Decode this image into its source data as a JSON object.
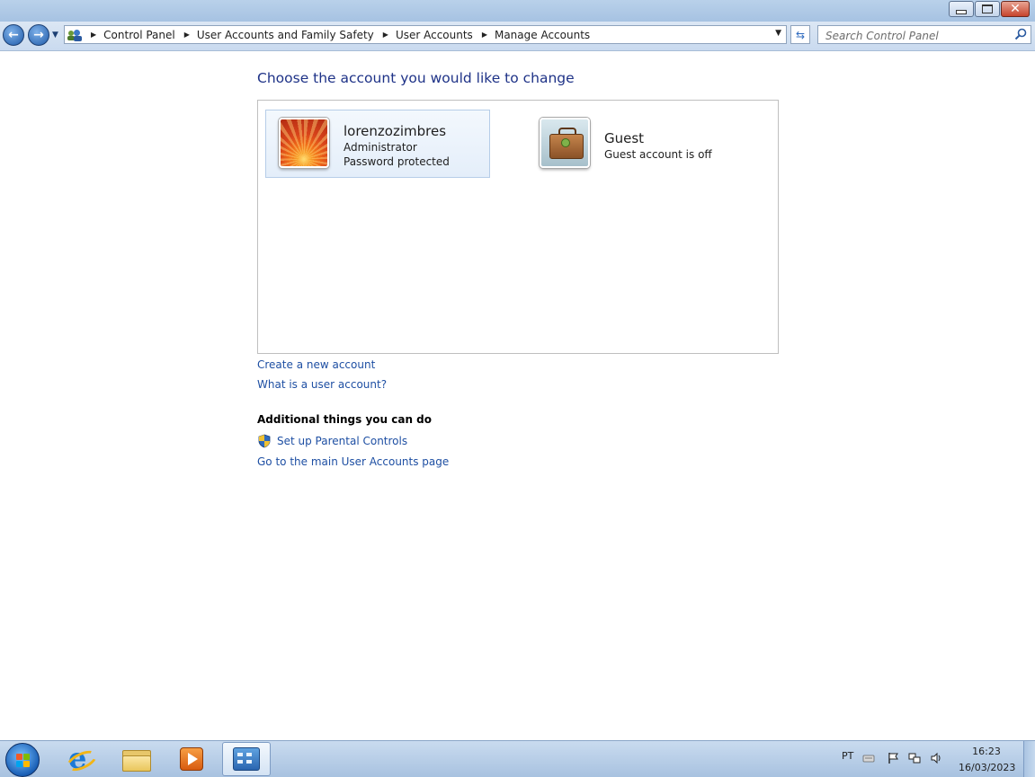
{
  "window": {
    "minimize_label": "",
    "restore_label": "",
    "close_label": "✕"
  },
  "nav": {
    "breadcrumbs": [
      "Control Panel",
      "User Accounts and Family Safety",
      "User Accounts",
      "Manage Accounts"
    ],
    "search_placeholder": "Search Control Panel"
  },
  "main": {
    "heading": "Choose the account you would like to change",
    "accounts": [
      {
        "name": "lorenzozimbres",
        "line1": "Administrator",
        "line2": "Password protected",
        "selected": true,
        "avatar": "orange-flower-picture"
      },
      {
        "name": "Guest",
        "line1": "Guest account is off",
        "selected": false,
        "avatar": "briefcase-picture"
      }
    ],
    "links": {
      "create": "Create a new account",
      "what_is": "What is a user account?"
    },
    "additional": {
      "title": "Additional things you can do",
      "parental": "Set up Parental Controls",
      "main_page": "Go to the main User Accounts page"
    }
  },
  "taskbar": {
    "items": [
      "start-orb-icon",
      "internet-explorer-icon",
      "windows-explorer-icon",
      "media-player-icon",
      "control-panel-icon"
    ],
    "language": "PT",
    "time": "16:23",
    "date": "16/03/2023"
  },
  "colors": {
    "heading": "#1e3287",
    "link": "#1e4fa3",
    "selected_tile_border": "#b6cde8"
  }
}
